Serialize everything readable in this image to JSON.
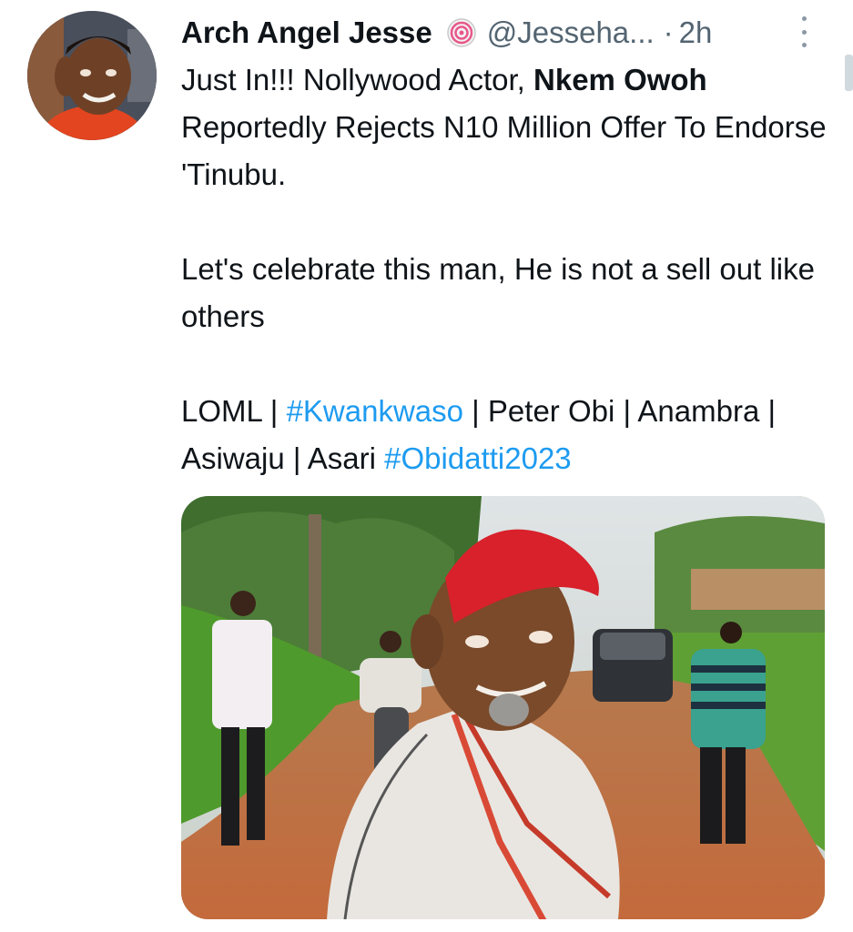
{
  "tweet": {
    "display_name": "Arch Angel Jesse",
    "verified_icon": "lollipop-badge-icon",
    "handle": "@Jesseha...",
    "separator": "·",
    "time": "2h",
    "text": {
      "line1_prefix": "Just In!!! Nollywood Actor, ",
      "line1_bold": "Nkem Owoh",
      "line1_suffix": " Reportedly Rejects N10 Million Offer To Endorse 'Tinubu.",
      "line2": "Let's celebrate this man, He is not a sell out like others",
      "line3_part1": "LOML | ",
      "hashtag1": "#Kwankwaso",
      "line3_part2": " | Peter Obi | Anambra | Asiwaju | Asari ",
      "hashtag2": "#Obidatti2023"
    },
    "more_icon": "more-vertical-icon",
    "media_description": "photo"
  },
  "colors": {
    "text": "#0f1419",
    "secondary": "#536471",
    "link": "#1d9bf0"
  }
}
